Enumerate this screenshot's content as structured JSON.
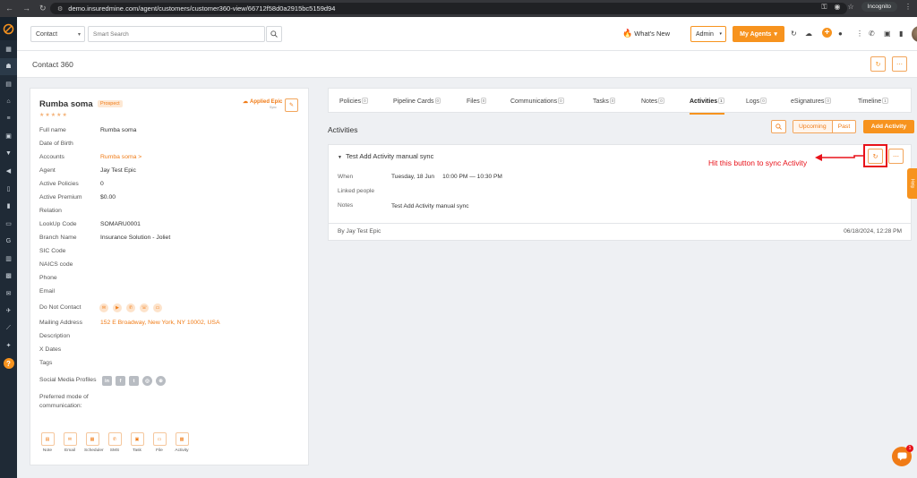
{
  "browser": {
    "url": "demo.insuredmine.com/agent/customers/customer360-view/66712f58d0a2915bc5159d94",
    "incognito_label": "Incognito"
  },
  "topbar": {
    "contact_select": "Contact",
    "search_placeholder": "Smart Search",
    "whats_new": "What's New",
    "role_select": "Admin",
    "my_agents": "My Agents"
  },
  "page": {
    "title": "Contact 360"
  },
  "contact": {
    "name": "Rumba soma",
    "status_badge": "Prospect",
    "rating_stars": "★★★★★",
    "integration_label": "Applied Epic",
    "integration_sub": "Sync",
    "fields": [
      {
        "label": "Full name",
        "value": "Rumba soma"
      },
      {
        "label": "Date of Birth",
        "value": ""
      },
      {
        "label": "Accounts",
        "value": "Rumba soma >"
      },
      {
        "label": "Agent",
        "value": "Jay Test Epic"
      },
      {
        "label": "Active Policies",
        "value": "0"
      },
      {
        "label": "Active Premium",
        "value": "$0.00"
      },
      {
        "label": "Relation",
        "value": ""
      },
      {
        "label": "LookUp Code",
        "value": "SOMARU0001"
      },
      {
        "label": "Branch Name",
        "value": "Insurance Solution - Joliet"
      },
      {
        "label": "SIC Code",
        "value": ""
      },
      {
        "label": "NAICS code",
        "value": ""
      },
      {
        "label": "Phone",
        "value": ""
      },
      {
        "label": "Email",
        "value": ""
      },
      {
        "label": "Do Not Contact",
        "value": ""
      },
      {
        "label": "Mailing Address",
        "value": "152 E Broadway, New York, NY 10002, USA"
      },
      {
        "label": "Description",
        "value": ""
      },
      {
        "label": "X Dates",
        "value": ""
      },
      {
        "label": "Tags",
        "value": ""
      },
      {
        "label": "Social Media Profiles",
        "value": ""
      }
    ],
    "preferred_mode_label": "Preferred mode of communication:",
    "quick_actions": [
      "Note",
      "Email",
      "Scheduler",
      "SMS",
      "Task",
      "File",
      "Activity"
    ]
  },
  "tabs": [
    {
      "label": "Policies",
      "count": "0"
    },
    {
      "label": "Pipeline Cards",
      "count": "0"
    },
    {
      "label": "Files",
      "count": "0"
    },
    {
      "label": "Communications",
      "count": "0"
    },
    {
      "label": "Tasks",
      "count": "0"
    },
    {
      "label": "Notes",
      "count": "0"
    },
    {
      "label": "Activities",
      "count": "1"
    },
    {
      "label": "Logs",
      "count": "0"
    },
    {
      "label": "eSignatures",
      "count": "0"
    },
    {
      "label": "Timeline",
      "count": "1"
    }
  ],
  "activities": {
    "section_title": "Activities",
    "toggle_upcoming": "Upcoming",
    "toggle_past": "Past",
    "add_button": "Add Activity",
    "item": {
      "title": "Test Add Activity manual sync",
      "when_label": "When",
      "when_value": "Tuesday, 18 Jun     10:00 PM — 10:30 PM",
      "linked_label": "Linked people",
      "notes_label": "Notes",
      "notes_value": "Test Add Activity manual sync",
      "by": "By Jay Test Epic",
      "timestamp": "06/18/2024, 12:28 PM"
    }
  },
  "annotation": "Hit this button to sync  Activity",
  "help_tab": "Help",
  "chat_badge": "1"
}
